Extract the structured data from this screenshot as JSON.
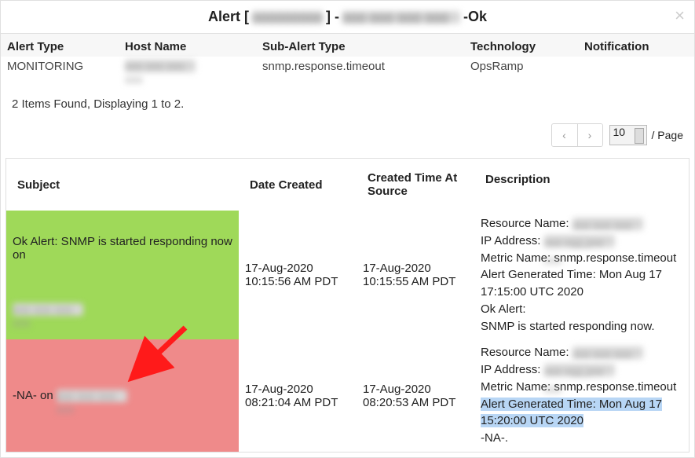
{
  "header": {
    "title_prefix": "Alert [",
    "title_redacted1": "000000000",
    "title_mid": "] -",
    "title_redacted2": "000 000 000 000",
    "title_suffix": "-Ok",
    "close_symbol": "×"
  },
  "info": {
    "labels": {
      "alert_type": "Alert Type",
      "host_name": "Host Name",
      "sub_alert_type": "Sub-Alert Type",
      "technology": "Technology",
      "notification": "Notification"
    },
    "values": {
      "alert_type": "MONITORING",
      "host_name_redacted": "xxx xxx xxx xxx",
      "sub_alert_type": "snmp.response.timeout",
      "technology": "OpsRamp",
      "notification": ""
    }
  },
  "summary": "2 Items Found, Displaying 1 to 2.",
  "pager": {
    "prev": "‹",
    "next": "›",
    "page_size": "10",
    "per_page_label": "/ Page"
  },
  "grid": {
    "columns": {
      "subject": "Subject",
      "date_created": "Date Created",
      "created_at_source": "Created Time At Source",
      "description": "Description"
    },
    "rows": [
      {
        "kind": "ok",
        "subject_prefix": "Ok Alert: SNMP is started responding now on",
        "subject_redacted": "xxx xxx xxx xxx",
        "date_created": "17-Aug-2020 10:15:56 AM PDT",
        "created_at_source": "17-Aug-2020 10:15:55 AM PDT",
        "desc": {
          "resource_label": "Resource Name:",
          "resource_redacted": "xxx xxx xxx xxx",
          "ip_label": "IP Address:",
          "ip_redacted": "xxx xxx xxx xxx",
          "metric": "Metric Name: snmp.response.timeout",
          "gen_time": "Alert Generated Time: Mon Aug 17 17:15:00 UTC 2020",
          "blank": " ",
          "ok_alert": "Ok Alert:",
          "blank2": " ",
          "snmp_line": "SNMP is started responding now."
        }
      },
      {
        "kind": "na",
        "subject_prefix": "-NA- on",
        "subject_redacted": "xxx xxx xxx xxx",
        "date_created": "17-Aug-2020 08:21:04 AM PDT",
        "created_at_source": "17-Aug-2020 08:20:53 AM PDT",
        "desc": {
          "resource_label": "Resource Name:",
          "resource_redacted": "xxx xxx xxx xxx",
          "ip_label": "IP Address:",
          "ip_redacted": "xxx xxx xxx xxx",
          "metric": "Metric Name: snmp.response.timeout",
          "gen_time": "Alert Generated Time: Mon Aug 17 15:20:00 UTC 2020",
          "na_line": "-NA-."
        }
      }
    ]
  }
}
